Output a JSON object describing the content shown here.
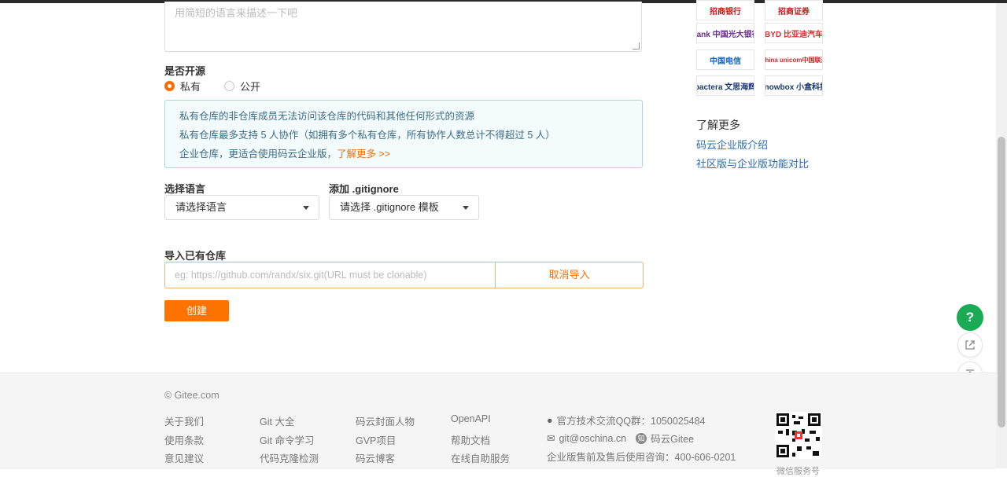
{
  "form": {
    "description_placeholder": "用简短的语言来描述一下吧",
    "open_source_label": "是否开源",
    "radio_private": "私有",
    "radio_public": "公开",
    "info_line1": "私有仓库的非仓库成员无法访问该仓库的代码和其他任何形式的资源",
    "info_line2": "私有仓库最多支持 5 人协作（如拥有多个私有仓库，所有协作人数总计不得超过 5 人）",
    "info_line3": "企业仓库，更适合使用码云企业版，",
    "info_more": "了解更多 >>",
    "language_label": "选择语言",
    "language_value": "请选择语言",
    "gitignore_label": "添加 .gitignore",
    "gitignore_value": "请选择 .gitignore 模板",
    "import_label": "导入已有仓库",
    "import_placeholder": "eg: https://github.com/randx/six.git(URL must be clonable)",
    "cancel_import": "取消导入",
    "create_button": "创建"
  },
  "sidebar": {
    "logos": [
      {
        "text": "招商银行",
        "color": "#c8161d"
      },
      {
        "text": "招商证券",
        "color": "#c8161d"
      },
      {
        "text": "Bank 中国光大银行",
        "color": "#6a2c8a"
      },
      {
        "text": "BYD 比亚迪汽车",
        "color": "#d32f2f"
      },
      {
        "text": "中国电信",
        "color": "#1565c0"
      },
      {
        "text": "China unicom中国联通",
        "color": "#c62828"
      },
      {
        "text": "pactera 文思海辉",
        "color": "#1a3a6b"
      },
      {
        "text": "knowbox 小盒科技",
        "color": "#1a3a6b"
      }
    ],
    "learn_more_title": "了解更多",
    "links": [
      "码云企业版介绍",
      "社区版与企业版功能对比"
    ]
  },
  "fab": {
    "help": "?"
  },
  "footer": {
    "copyright": "© Gitee.com",
    "col1": [
      "关于我们",
      "使用条款",
      "意见建议"
    ],
    "col2": [
      "Git 大全",
      "Git 命令学习",
      "代码克隆检测"
    ],
    "col3": [
      "码云封面人物",
      "GVP项目",
      "码云博客"
    ],
    "col4": [
      "OpenAPI",
      "帮助文档",
      "在线自助服务"
    ],
    "qq_group": "官方技术交流QQ群：1050025484",
    "email": "git@oschina.cn",
    "zhihu": "码云Gitee",
    "sales": "企业版售前及售后使用咨询：400-606-0201",
    "qr_caption": "微信服务号"
  }
}
